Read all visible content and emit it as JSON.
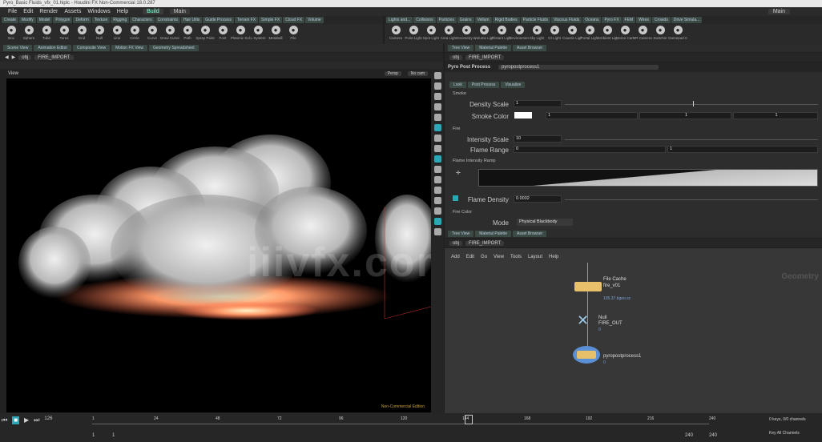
{
  "window": {
    "title": "Pyro_Basic Fluids_vfx_01.hiplc - Houdini FX Non-Commercial 18.0.287"
  },
  "menu": {
    "items": [
      "File",
      "Edit",
      "Render",
      "Assets",
      "Windows",
      "Help"
    ],
    "desktop": "Build",
    "main": "Main",
    "right": "Main"
  },
  "left_shelf_tabs": [
    "Create",
    "Modify",
    "Model",
    "Polygon",
    "Deform",
    "Texture",
    "Rigging",
    "Characters",
    "Constraints",
    "Hair Utils",
    "Guide Process",
    "Terrain FX",
    "Simple FX",
    "Cloud FX",
    "Volume"
  ],
  "right_shelf_tabs": [
    "Lights and...",
    "Collisions",
    "Particles",
    "Grains",
    "Vellum",
    "Rigid Bodies",
    "Particle Fluids",
    "Viscous Fluids",
    "Oceans",
    "Pyro FX",
    "FEM",
    "Wires",
    "Crowds",
    "Drive Simula..."
  ],
  "left_tools": [
    "Box",
    "Sphere",
    "Tube",
    "Torus",
    "Grid",
    "Null",
    "Line",
    "Circle",
    "Curve",
    "Draw Curve",
    "Path",
    "Spray Paint",
    "Font",
    "Platonic Solids",
    "L-System",
    "Metaball",
    "File"
  ],
  "right_tools": [
    "Camera",
    "Point Light",
    "Spot Light",
    "Area Light",
    "Geometry Light",
    "Volume Light",
    "Distant Light",
    "Environment Light",
    "Sky Light",
    "GI Light",
    "Caustic Light",
    "Portal Light",
    "Ambient Light",
    "Stereo Camera",
    "VR Camera",
    "Switcher",
    "Gamepad Camera"
  ],
  "viewer": {
    "pane_tabs": [
      "Scene View",
      "Animation Editor",
      "Composite View",
      "Motion FX View",
      "Geometry Spreadsheet"
    ],
    "obj": "obj",
    "node": "FIRE_IMPORT",
    "title": "View",
    "persp": "Persp",
    "cam": "No cam",
    "status": "Non-Commercial Edition"
  },
  "params": {
    "pane_tabs": [
      "Tree View",
      "Material Palette",
      "Asset Browser"
    ],
    "obj": "obj",
    "node": "FIRE_IMPORT",
    "type": "Pyro Post Process",
    "name": "pyropostprocess1",
    "tabs": [
      "Look",
      "Post Process",
      "Visualize"
    ],
    "smoke_section": "Smoke",
    "density_scale_label": "Density Scale",
    "density_scale": "1",
    "smoke_color_label": "Smoke Color",
    "smoke_color": [
      "1",
      "1",
      "1"
    ],
    "fire_section": "Fire",
    "intensity_scale_label": "Intensity Scale",
    "intensity_scale": "10",
    "flame_range_label": "Flame Range",
    "flame_range": [
      "0",
      "1"
    ],
    "ramp_label": "Flame Intensity Ramp",
    "flame_density_label": "Flame Density",
    "flame_density": "0.0002",
    "fire_color_section": "Fire Color",
    "mode_label": "Mode",
    "mode": "Physical Blackbody"
  },
  "network": {
    "pane_tabs": [
      "Tree View",
      "Material Palette",
      "Asset Browser"
    ],
    "obj": "obj",
    "node": "FIRE_IMPORT",
    "menus": [
      "Add",
      "Edit",
      "Go",
      "View",
      "Tools",
      "Layout",
      "Help"
    ],
    "context": "Geometry",
    "nodes": [
      {
        "type": "File Cache",
        "name": "fire_v01",
        "sub": "105.37.bgeo.sc"
      },
      {
        "type": "Null",
        "name": "FIRE_OUT",
        "sub": "0"
      },
      {
        "type": "",
        "name": "pyropostprocess1",
        "sub": "0"
      }
    ]
  },
  "timeline": {
    "frame": "126",
    "start": "1",
    "end_a": "1",
    "cur": "240",
    "range": "240",
    "ticks": [
      "1",
      "24",
      "48",
      "72",
      "96",
      "120",
      "144",
      "168",
      "192",
      "216",
      "240"
    ],
    "keys": "0 keys, 0/0 channels",
    "keyall": "Key All Channels"
  },
  "watermark": "iiivfx.com",
  "colors": {
    "accent": "#2aa8b8",
    "node_yellow": "#e8c06a",
    "node_blue": "#5b8fd6"
  }
}
